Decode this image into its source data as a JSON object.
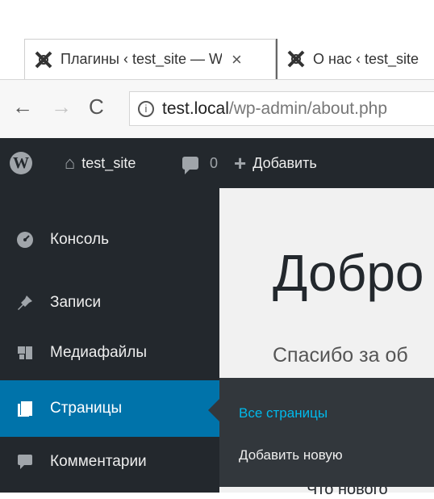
{
  "browser": {
    "tabs": [
      {
        "title": "Плагины ‹ test_site — W",
        "close_label": "×"
      },
      {
        "title": "О нас ‹ test_site"
      }
    ],
    "nav": {
      "back": "←",
      "forward": "→",
      "reload": "C"
    },
    "url": {
      "host": "test.local",
      "path": "/wp-admin/about.php"
    }
  },
  "adminbar": {
    "logo": "W",
    "site_name": "test_site",
    "comments_count": "0",
    "add_label": "Добавить"
  },
  "sidebar": {
    "items": [
      {
        "label": "Консоль",
        "icon": "dashboard-icon"
      },
      {
        "label": "Записи",
        "icon": "pin-icon"
      },
      {
        "label": "Медиафайлы",
        "icon": "media-icon"
      },
      {
        "label": "Страницы",
        "icon": "pages-icon"
      },
      {
        "label": "Комментарии",
        "icon": "comment-icon"
      }
    ],
    "submenu": [
      {
        "label": "Все страницы"
      },
      {
        "label": "Добавить новую"
      }
    ]
  },
  "content": {
    "welcome": "Добро",
    "thanks": "Спасибо за об",
    "partial": "Что нового"
  },
  "colors": {
    "admin_bg": "#23282d",
    "accent": "#0073aa",
    "submenu_active": "#00b9eb"
  }
}
